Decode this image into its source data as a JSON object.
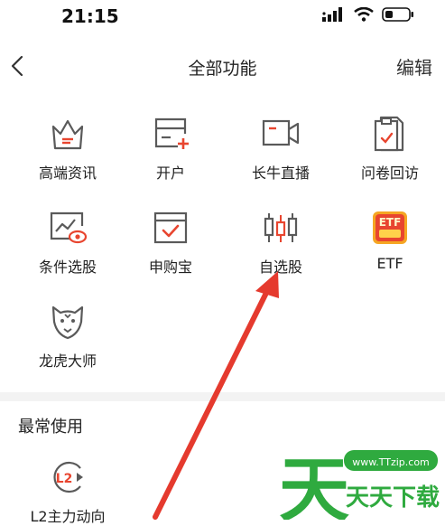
{
  "status_bar": {
    "time": "21:15"
  },
  "header": {
    "title": "全部功能",
    "edit_label": "编辑"
  },
  "functions": [
    {
      "label": "高端资讯",
      "icon": "crown-icon"
    },
    {
      "label": "开户",
      "icon": "account-card-icon"
    },
    {
      "label": "长牛直播",
      "icon": "video-camera-icon"
    },
    {
      "label": "问卷回访",
      "icon": "clipboard-icon"
    },
    {
      "label": "条件选股",
      "icon": "chart-eye-icon"
    },
    {
      "label": "申购宝",
      "icon": "checkbox-icon"
    },
    {
      "label": "自选股",
      "icon": "candlestick-icon"
    },
    {
      "label": "ETF",
      "icon": "etf-badge-icon"
    },
    {
      "label": "龙虎大师",
      "icon": "tiger-icon"
    }
  ],
  "frequent": {
    "title": "最常使用",
    "items": [
      {
        "label": "L2主力动向",
        "icon": "l2-icon",
        "icon_text": "L2"
      }
    ]
  },
  "watermark": {
    "url": "www.TTzip.com",
    "text": "天天下载"
  },
  "colors": {
    "accent": "#e8452f",
    "icon_gray": "#5a5a5a",
    "arrow_red": "#e53a2e",
    "watermark_green": "#2faa3f"
  }
}
